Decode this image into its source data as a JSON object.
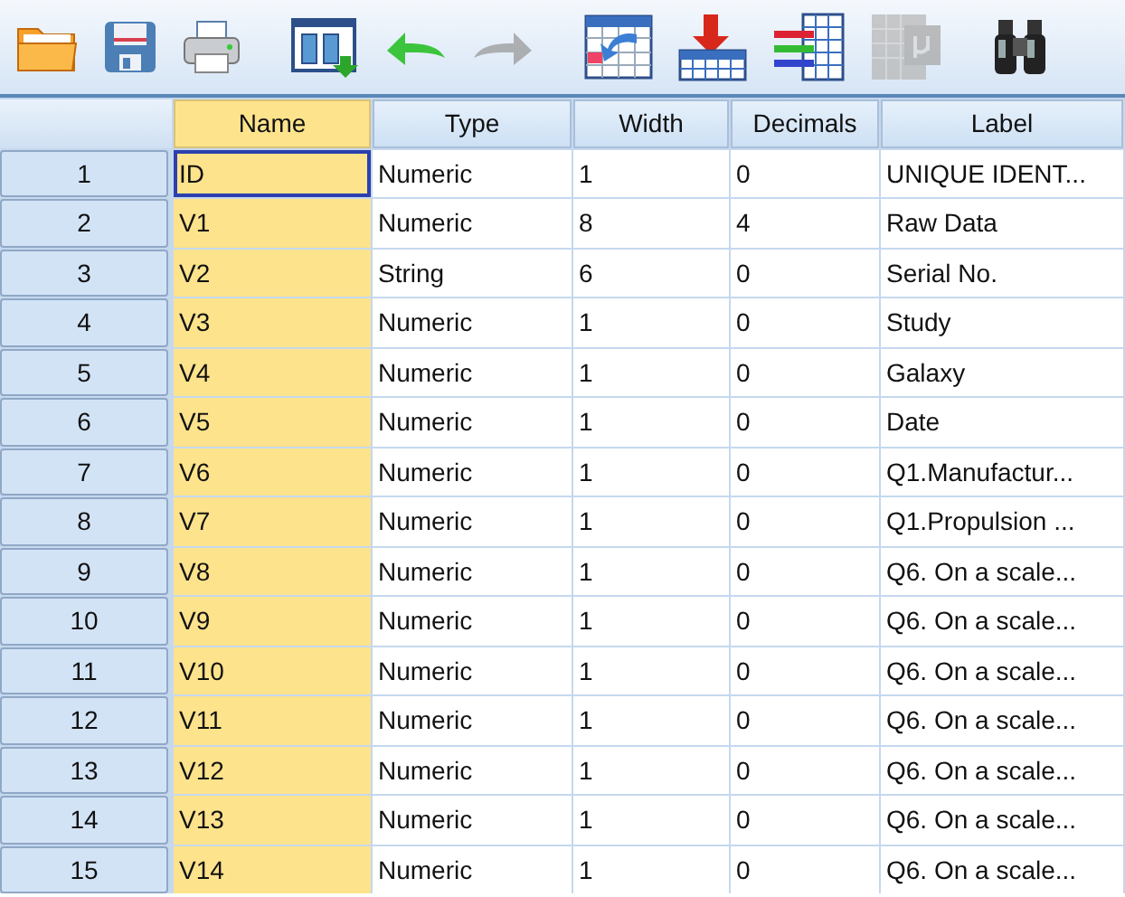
{
  "toolbar": [
    {
      "kind": "open",
      "disabled": false
    },
    {
      "kind": "save",
      "disabled": false
    },
    {
      "kind": "print",
      "disabled": false
    },
    {
      "kind": "dialog",
      "disabled": false
    },
    {
      "kind": "undo",
      "disabled": false
    },
    {
      "kind": "redo",
      "disabled": true
    },
    {
      "kind": "goto",
      "disabled": false
    },
    {
      "kind": "insert",
      "disabled": false
    },
    {
      "kind": "variables",
      "disabled": false
    },
    {
      "kind": "grid",
      "disabled": true
    },
    {
      "kind": "find",
      "disabled": false
    }
  ],
  "table": {
    "columns": [
      {
        "label": "Name",
        "selected": true
      },
      {
        "label": "Type",
        "selected": false
      },
      {
        "label": "Width",
        "selected": false
      },
      {
        "label": "Decimals",
        "selected": false
      },
      {
        "label": "Label",
        "selected": false
      }
    ],
    "rows": [
      {
        "number": "1",
        "cells": [
          "ID",
          "Numeric",
          "1",
          "0",
          "UNIQUE IDENT..."
        ],
        "active_cell": true
      },
      {
        "number": "2",
        "cells": [
          "V1",
          "Numeric",
          "8",
          "4",
          "Raw Data"
        ],
        "active_cell": false
      },
      {
        "number": "3",
        "cells": [
          "V2",
          "String",
          "6",
          "0",
          "Serial No."
        ],
        "active_cell": false
      },
      {
        "number": "4",
        "cells": [
          "V3",
          "Numeric",
          "1",
          "0",
          "Study"
        ],
        "active_cell": false
      },
      {
        "number": "5",
        "cells": [
          "V4",
          "Numeric",
          "1",
          "0",
          "Galaxy"
        ],
        "active_cell": false
      },
      {
        "number": "6",
        "cells": [
          "V5",
          "Numeric",
          "1",
          "0",
          "Date"
        ],
        "active_cell": false
      },
      {
        "number": "7",
        "cells": [
          "V6",
          "Numeric",
          "1",
          "0",
          "Q1.Manufactur..."
        ],
        "active_cell": false
      },
      {
        "number": "8",
        "cells": [
          "V7",
          "Numeric",
          "1",
          "0",
          "Q1.Propulsion ..."
        ],
        "active_cell": false
      },
      {
        "number": "9",
        "cells": [
          "V8",
          "Numeric",
          "1",
          "0",
          "Q6. On a scale..."
        ],
        "active_cell": false
      },
      {
        "number": "10",
        "cells": [
          "V9",
          "Numeric",
          "1",
          "0",
          "Q6. On a scale..."
        ],
        "active_cell": false
      },
      {
        "number": "11",
        "cells": [
          "V10",
          "Numeric",
          "1",
          "0",
          "Q6. On a scale..."
        ],
        "active_cell": false
      },
      {
        "number": "12",
        "cells": [
          "V11",
          "Numeric",
          "1",
          "0",
          "Q6. On a scale..."
        ],
        "active_cell": false
      },
      {
        "number": "13",
        "cells": [
          "V12",
          "Numeric",
          "1",
          "0",
          "Q6. On a scale..."
        ],
        "active_cell": false
      },
      {
        "number": "14",
        "cells": [
          "V13",
          "Numeric",
          "1",
          "0",
          "Q6. On a scale..."
        ],
        "active_cell": false
      },
      {
        "number": "15",
        "cells": [
          "V14",
          "Numeric",
          "1",
          "0",
          "Q6. On a scale..."
        ],
        "active_cell": false
      }
    ]
  }
}
